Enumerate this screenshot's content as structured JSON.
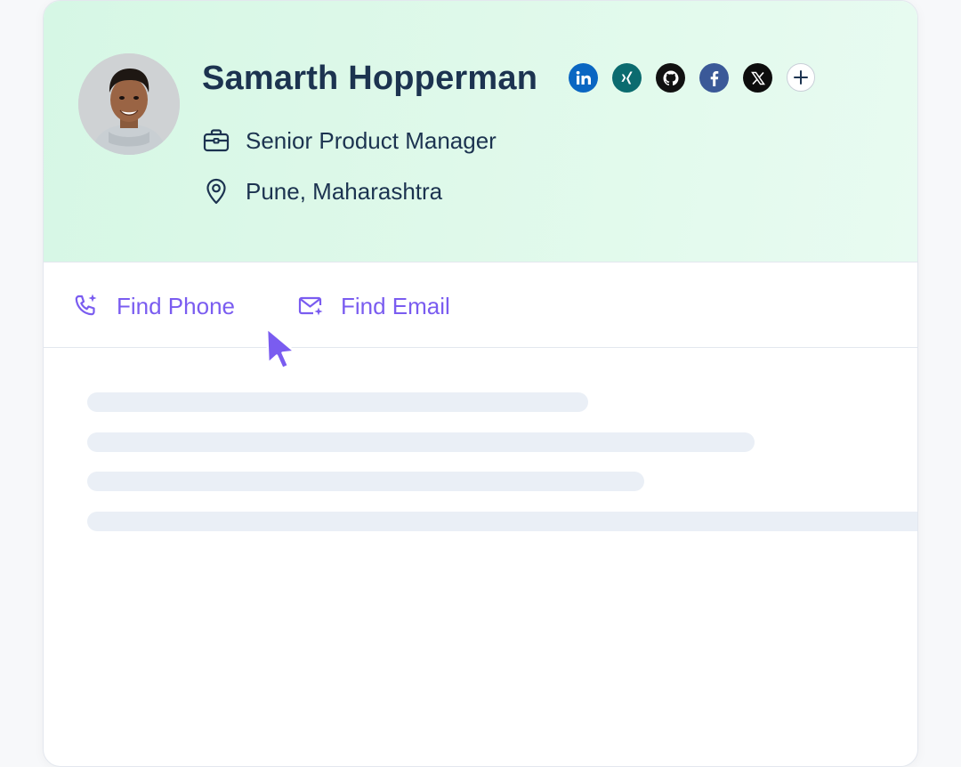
{
  "profile": {
    "name": "Samarth Hopperman",
    "title": "Senior Product Manager",
    "location": "Pune, Maharashtra"
  },
  "socials": [
    {
      "icon": "linkedin-icon",
      "color": "#0a66c2"
    },
    {
      "icon": "xing-icon",
      "color": "#0b6b6f"
    },
    {
      "icon": "github-icon",
      "color": "#111111"
    },
    {
      "icon": "facebook-icon",
      "color": "#3b5998"
    },
    {
      "icon": "x-twitter-icon",
      "color": "#0d0d0d"
    },
    {
      "icon": "add-icon",
      "color": "#ffffff"
    }
  ],
  "actions": {
    "find_phone": "Find Phone",
    "find_email": "Find Email"
  },
  "colors": {
    "header_bg": "#d9f8e8",
    "text_primary": "#1c3350",
    "accent": "#7a5cf0",
    "skeleton": "#eaeff6"
  }
}
